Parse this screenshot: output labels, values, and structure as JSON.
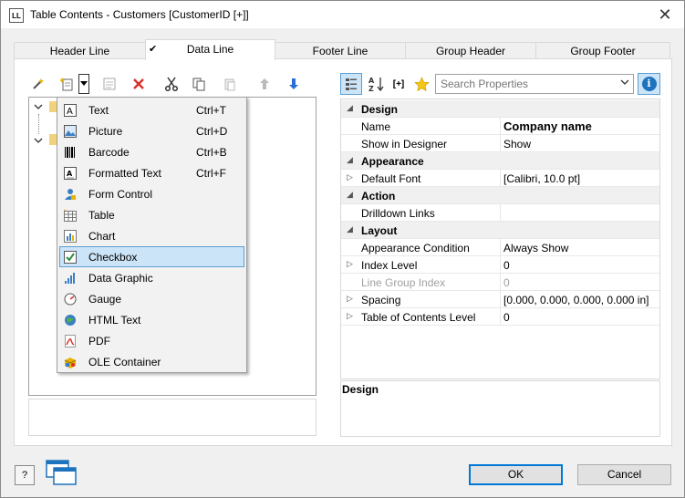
{
  "window": {
    "app_icon_text": "LL",
    "title": "Table Contents - Customers [CustomerID [+]]",
    "close_glyph": "✕"
  },
  "tabs": [
    {
      "label": "Header Line",
      "active": false
    },
    {
      "label": "Data Line",
      "active": true,
      "check_glyph": "✔"
    },
    {
      "label": "Footer Line",
      "active": false
    },
    {
      "label": "Group Header",
      "active": false
    },
    {
      "label": "Group Footer",
      "active": false
    }
  ],
  "left_toolbar": {
    "icons": [
      "wand-icon",
      "new-item-icon",
      "dropdown-arrow-icon",
      "properties-icon",
      "delete-icon",
      "cut-icon",
      "copy-icon",
      "paste-icon",
      "move-up-icon",
      "move-down-icon"
    ]
  },
  "insert_menu": {
    "items": [
      {
        "label": "Text",
        "shortcut": "Ctrl+T",
        "icon": "text-icon",
        "selected": false
      },
      {
        "label": "Picture",
        "shortcut": "Ctrl+D",
        "icon": "picture-icon",
        "selected": false
      },
      {
        "label": "Barcode",
        "shortcut": "Ctrl+B",
        "icon": "barcode-icon",
        "selected": false
      },
      {
        "label": "Formatted Text",
        "shortcut": "Ctrl+F",
        "icon": "formatted-text-icon",
        "selected": false
      },
      {
        "label": "Form Control",
        "shortcut": "",
        "icon": "form-control-icon",
        "selected": false
      },
      {
        "label": "Table",
        "shortcut": "",
        "icon": "table-icon",
        "selected": false
      },
      {
        "label": "Chart",
        "shortcut": "",
        "icon": "chart-icon",
        "selected": false
      },
      {
        "label": "Checkbox",
        "shortcut": "",
        "icon": "checkbox-icon",
        "selected": true
      },
      {
        "label": "Data Graphic",
        "shortcut": "",
        "icon": "data-graphic-icon",
        "selected": false
      },
      {
        "label": "Gauge",
        "shortcut": "",
        "icon": "gauge-icon",
        "selected": false
      },
      {
        "label": "HTML Text",
        "shortcut": "",
        "icon": "html-text-icon",
        "selected": false
      },
      {
        "label": "PDF",
        "shortcut": "",
        "icon": "pdf-icon",
        "selected": false
      },
      {
        "label": "OLE Container",
        "shortcut": "",
        "icon": "ole-container-icon",
        "selected": false
      }
    ]
  },
  "right_toolbar": {
    "icons": [
      "categorized-icon",
      "sort-alpha-icon",
      "expand-all-icon",
      "favorites-star-icon",
      "info-icon"
    ],
    "expand_all_text": "[+]",
    "info_text": "i"
  },
  "search": {
    "placeholder": "Search Properties",
    "value": ""
  },
  "properties": [
    {
      "type": "category",
      "name": "Design",
      "expander": "◢"
    },
    {
      "type": "prop",
      "name": "Name",
      "value": "Company name",
      "bold_value": true,
      "expander": ""
    },
    {
      "type": "prop",
      "name": "Show in Designer",
      "value": "Show",
      "expander": ""
    },
    {
      "type": "category",
      "name": "Appearance",
      "expander": "◢"
    },
    {
      "type": "prop",
      "name": "Default Font",
      "value": "[Calibri, 10.0 pt]",
      "expander": "▷"
    },
    {
      "type": "category",
      "name": "Action",
      "expander": "◢"
    },
    {
      "type": "prop",
      "name": "Drilldown Links",
      "value": "",
      "expander": ""
    },
    {
      "type": "category",
      "name": "Layout",
      "expander": "◢"
    },
    {
      "type": "prop",
      "name": "Appearance Condition",
      "value": "Always Show",
      "expander": ""
    },
    {
      "type": "prop",
      "name": "Index Level",
      "value": "0",
      "expander": "▷"
    },
    {
      "type": "prop",
      "name": "Line Group Index",
      "value": "0",
      "expander": "",
      "disabled": true
    },
    {
      "type": "prop",
      "name": "Spacing",
      "value": "[0.000, 0.000, 0.000, 0.000 in]",
      "expander": "▷"
    },
    {
      "type": "prop",
      "name": "Table of Contents Level",
      "value": "0",
      "expander": "▷"
    }
  ],
  "property_description": {
    "title": "Design"
  },
  "footer": {
    "help_text": "?",
    "ok_label": "OK",
    "cancel_label": "Cancel"
  },
  "colors": {
    "accent": "#0078d7",
    "selection_bg": "#cce4f7",
    "selection_border": "#5d9fd2",
    "delete_red": "#d9302b",
    "arrow_blue": "#2a6fd6"
  }
}
